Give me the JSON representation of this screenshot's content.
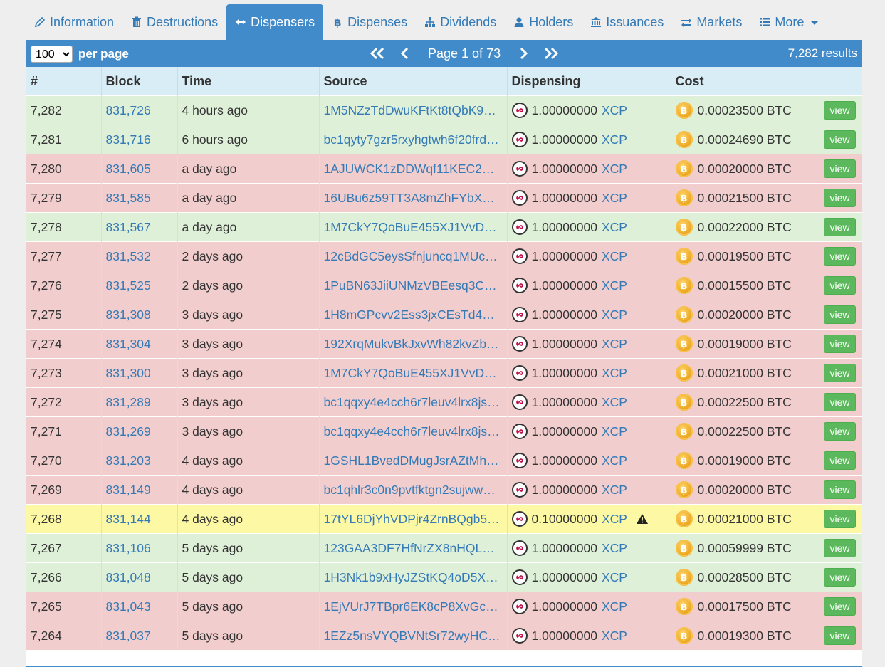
{
  "tabs": [
    {
      "label": "Information",
      "icon": "pencil-icon",
      "active": false
    },
    {
      "label": "Destructions",
      "icon": "trash-icon",
      "active": false
    },
    {
      "label": "Dispensers",
      "icon": "arrows-horizontal-icon",
      "active": true
    },
    {
      "label": "Dispenses",
      "icon": "bitcoin-icon",
      "active": false
    },
    {
      "label": "Dividends",
      "icon": "sitemap-icon",
      "active": false
    },
    {
      "label": "Holders",
      "icon": "user-icon",
      "active": false
    },
    {
      "label": "Issuances",
      "icon": "bank-icon",
      "active": false
    },
    {
      "label": "Markets",
      "icon": "exchange-icon",
      "active": false
    },
    {
      "label": "More",
      "icon": "list-icon",
      "active": false
    }
  ],
  "toolbar": {
    "per_page_value": "100",
    "per_page_options": [
      "100"
    ],
    "per_page_label": "per page",
    "page_label": "Page 1 of 73",
    "results_label": "7,282 results"
  },
  "table": {
    "columns": [
      "#",
      "Block",
      "Time",
      "Source",
      "Dispensing",
      "Cost"
    ],
    "view_label": "view",
    "rows": [
      {
        "status": "green",
        "num": "7,282",
        "block": "831,726",
        "time": "4 hours ago",
        "source": "1M5NZzTdDwuKFtKt8tQbK9…",
        "amount": "1.00000000",
        "asset": "XCP",
        "warn": false,
        "cost": "0.00023500 BTC"
      },
      {
        "status": "green",
        "num": "7,281",
        "block": "831,716",
        "time": "6 hours ago",
        "source": "bc1qyty7gzr5rxyhgtwh6f20frd…",
        "amount": "1.00000000",
        "asset": "XCP",
        "warn": false,
        "cost": "0.00024690 BTC"
      },
      {
        "status": "red",
        "num": "7,280",
        "block": "831,605",
        "time": "a day ago",
        "source": "1AJUWCK1zDDWqf11KEC2…",
        "amount": "1.00000000",
        "asset": "XCP",
        "warn": false,
        "cost": "0.00020000 BTC"
      },
      {
        "status": "red",
        "num": "7,279",
        "block": "831,585",
        "time": "a day ago",
        "source": "16UBu6z59TT3A8mZhFYbX…",
        "amount": "1.00000000",
        "asset": "XCP",
        "warn": false,
        "cost": "0.00021500 BTC"
      },
      {
        "status": "green",
        "num": "7,278",
        "block": "831,567",
        "time": "a day ago",
        "source": "1M7CkY7QoBuE455XJ1VvD…",
        "amount": "1.00000000",
        "asset": "XCP",
        "warn": false,
        "cost": "0.00022000 BTC"
      },
      {
        "status": "red",
        "num": "7,277",
        "block": "831,532",
        "time": "2 days ago",
        "source": "12cBdGC5eysSfnjuncq1MUc…",
        "amount": "1.00000000",
        "asset": "XCP",
        "warn": false,
        "cost": "0.00019500 BTC"
      },
      {
        "status": "red",
        "num": "7,276",
        "block": "831,525",
        "time": "2 days ago",
        "source": "1PuBN63JiiUNMzVBEesq3C…",
        "amount": "1.00000000",
        "asset": "XCP",
        "warn": false,
        "cost": "0.00015500 BTC"
      },
      {
        "status": "red",
        "num": "7,275",
        "block": "831,308",
        "time": "3 days ago",
        "source": "1H8mGPcvv2Ess3jxCEsTd4…",
        "amount": "1.00000000",
        "asset": "XCP",
        "warn": false,
        "cost": "0.00020000 BTC"
      },
      {
        "status": "red",
        "num": "7,274",
        "block": "831,304",
        "time": "3 days ago",
        "source": "192XrqMukvBkJxvWh82kvZb…",
        "amount": "1.00000000",
        "asset": "XCP",
        "warn": false,
        "cost": "0.00019000 BTC"
      },
      {
        "status": "red",
        "num": "7,273",
        "block": "831,300",
        "time": "3 days ago",
        "source": "1M7CkY7QoBuE455XJ1VvD…",
        "amount": "1.00000000",
        "asset": "XCP",
        "warn": false,
        "cost": "0.00021000 BTC"
      },
      {
        "status": "red",
        "num": "7,272",
        "block": "831,289",
        "time": "3 days ago",
        "source": "bc1qqxy4e4cch6r7leuv4lrx8js…",
        "amount": "1.00000000",
        "asset": "XCP",
        "warn": false,
        "cost": "0.00022500 BTC"
      },
      {
        "status": "red",
        "num": "7,271",
        "block": "831,269",
        "time": "3 days ago",
        "source": "bc1qqxy4e4cch6r7leuv4lrx8js…",
        "amount": "1.00000000",
        "asset": "XCP",
        "warn": false,
        "cost": "0.00022500 BTC"
      },
      {
        "status": "red",
        "num": "7,270",
        "block": "831,203",
        "time": "4 days ago",
        "source": "1GSHL1BvedDMugJsrAZtMh…",
        "amount": "1.00000000",
        "asset": "XCP",
        "warn": false,
        "cost": "0.00019000 BTC"
      },
      {
        "status": "red",
        "num": "7,269",
        "block": "831,149",
        "time": "4 days ago",
        "source": "bc1qhlr3c0n9pvtfktgn2sujww…",
        "amount": "1.00000000",
        "asset": "XCP",
        "warn": false,
        "cost": "0.00020000 BTC"
      },
      {
        "status": "yellow",
        "num": "7,268",
        "block": "831,144",
        "time": "4 days ago",
        "source": "17tYL6DjYhVDPjr4ZrnBQgb5…",
        "amount": "0.10000000",
        "asset": "XCP",
        "warn": true,
        "cost": "0.00021000 BTC"
      },
      {
        "status": "green",
        "num": "7,267",
        "block": "831,106",
        "time": "5 days ago",
        "source": "123GAA3DF7HfNrZX8nHQL…",
        "amount": "1.00000000",
        "asset": "XCP",
        "warn": false,
        "cost": "0.00059999 BTC"
      },
      {
        "status": "green",
        "num": "7,266",
        "block": "831,048",
        "time": "5 days ago",
        "source": "1H3Nk1b9xHyJZStKQ4oD5X…",
        "amount": "1.00000000",
        "asset": "XCP",
        "warn": false,
        "cost": "0.00028500 BTC"
      },
      {
        "status": "red",
        "num": "7,265",
        "block": "831,043",
        "time": "5 days ago",
        "source": "1EjVUrJ7TBpr6EK8cP8XvGc…",
        "amount": "1.00000000",
        "asset": "XCP",
        "warn": false,
        "cost": "0.00017500 BTC"
      },
      {
        "status": "red",
        "num": "7,264",
        "block": "831,037",
        "time": "5 days ago",
        "source": "1EZz5nsVYQBVNtSr72wyHC…",
        "amount": "1.00000000",
        "asset": "XCP",
        "warn": false,
        "cost": "0.00019300 BTC"
      }
    ]
  }
}
